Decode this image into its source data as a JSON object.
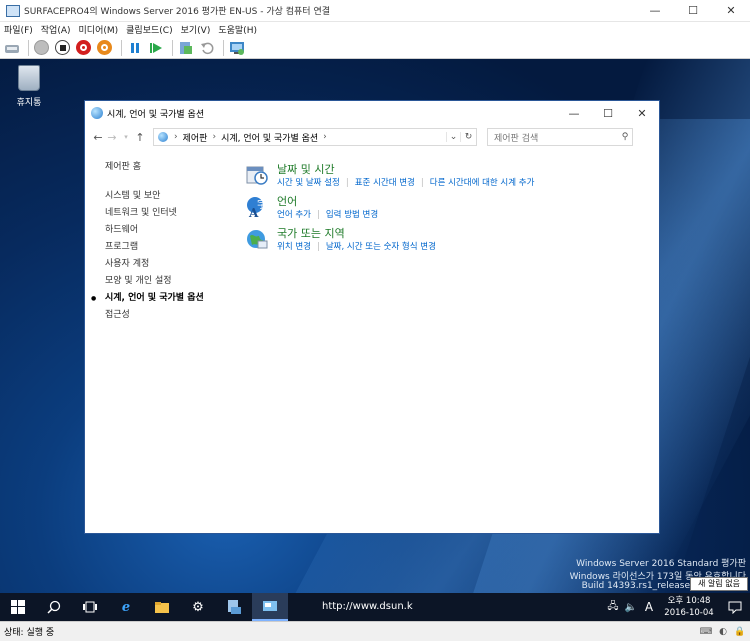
{
  "vm_window": {
    "title": "SURFACEPRO4의 Windows Server 2016 평가판 EN-US - 가상 컴퓨터 연결",
    "minimize": "—",
    "maximize": "☐",
    "close": "✕"
  },
  "menubar": [
    "파일(F)",
    "작업(A)",
    "미디어(M)",
    "클립보드(C)",
    "보기(V)",
    "도움말(H)"
  ],
  "toolbar_icons": [
    "ctrl-alt-del-icon",
    "start-icon",
    "turn-off-icon",
    "shutdown-icon",
    "save-icon",
    "pause-icon",
    "reset-icon",
    "checkpoint-icon",
    "revert-icon",
    "enhanced-session-icon"
  ],
  "desktop": {
    "recycle_bin_label": "휴지통"
  },
  "control_panel": {
    "title": "시계, 언어 및 국가별 옵션",
    "breadcrumb": [
      "제어판",
      "시계, 언어 및 국가별 옵션"
    ],
    "search_placeholder": "제어판 검색",
    "minimize": "—",
    "maximize": "☐",
    "close": "✕",
    "left_nav": {
      "home": "제어판 홈",
      "items": [
        "시스템 및 보안",
        "네트워크 및 인터넷",
        "하드웨어",
        "프로그램",
        "사용자 계정",
        "모양 및 개인 설정",
        "시계, 언어 및 국가별 옵션",
        "접근성"
      ],
      "active_index": 6
    },
    "categories": [
      {
        "title": "날짜 및 시간",
        "icon": "clock-calendar-icon",
        "links": [
          "시간 및 날짜 설정",
          "표준 시간대 변경",
          "다른 시간대에 대한 시계 추가"
        ]
      },
      {
        "title": "언어",
        "icon": "language-icon",
        "links": [
          "언어 추가",
          "입력 방법 변경"
        ]
      },
      {
        "title": "국가 또는 지역",
        "icon": "globe-icon",
        "links": [
          "위치 변경",
          "날짜, 시간 또는 숫자 형식 변경"
        ]
      }
    ]
  },
  "watermark": {
    "line1": "Windows Server 2016 Standard 평가판",
    "line2": "Windows 라이선스가 173일 동안 유효합니다",
    "line3": "Build 14393.rs1_release"
  },
  "notification_tooltip": "새 알림 없음",
  "taskbar": {
    "url_text": "http://www.dsun.k",
    "time": "오후 10:48",
    "date": "2016-10-04",
    "ime": "A"
  },
  "statusbar": {
    "status": "상태: 실행 중"
  }
}
